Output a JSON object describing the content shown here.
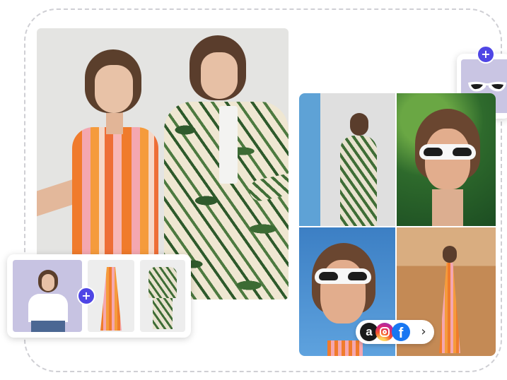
{
  "icons": {
    "plus": "+",
    "amazon": "a",
    "facebook": "f",
    "chevron": "›"
  },
  "colors": {
    "accent": "#4f46e5",
    "frame_dash": "#cfcfd4",
    "facebook": "#1877f2",
    "amazon": "#1a1a1a"
  },
  "social_share": {
    "platforms": [
      "amazon",
      "instagram",
      "facebook"
    ]
  }
}
